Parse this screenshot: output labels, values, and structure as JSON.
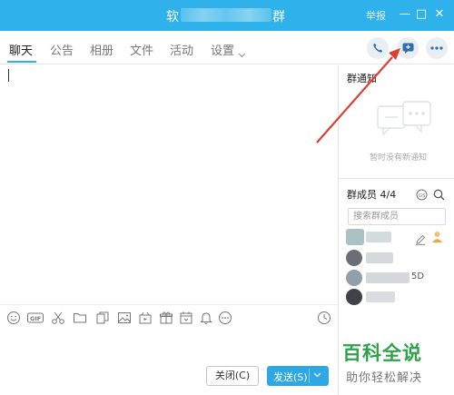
{
  "window": {
    "title_start": "软",
    "title_end": "群",
    "report_label": "举报",
    "minimize": "—",
    "maximize": "□",
    "close": "✕"
  },
  "tabs": [
    {
      "label": "聊天",
      "active": true
    },
    {
      "label": "公告"
    },
    {
      "label": "相册"
    },
    {
      "label": "文件"
    },
    {
      "label": "活动"
    },
    {
      "label": "设置"
    }
  ],
  "header_actions": [
    {
      "icon": "phone-icon"
    },
    {
      "icon": "add-app-icon"
    },
    {
      "icon": "more-icon"
    }
  ],
  "toolbar_icons": [
    "emoji-icon",
    "gif-icon",
    "scissors-icon",
    "folder-icon",
    "docs-icon",
    "image-icon",
    "media-icon",
    "gift-icon",
    "calendar-icon",
    "bell-icon",
    "more-dots-icon",
    "history-clock-icon"
  ],
  "composer": {
    "close_label": "关闭(C)",
    "send_label": "发送(S)"
  },
  "notice": {
    "title": "群通知",
    "empty_text": "暂时没有新通知"
  },
  "members": {
    "title": "群成员 4/4",
    "search_placeholder": "搜索群成员",
    "list_fragment": "5D"
  },
  "watermark": {
    "title": "百科全说",
    "subtitle": "助你轻松解决"
  },
  "colors": {
    "titlebar": "#2fb2ec",
    "send_button": "#2fa7e6",
    "annotation_arrow": "#e03c31",
    "watermark_green": "#2fa24a"
  }
}
